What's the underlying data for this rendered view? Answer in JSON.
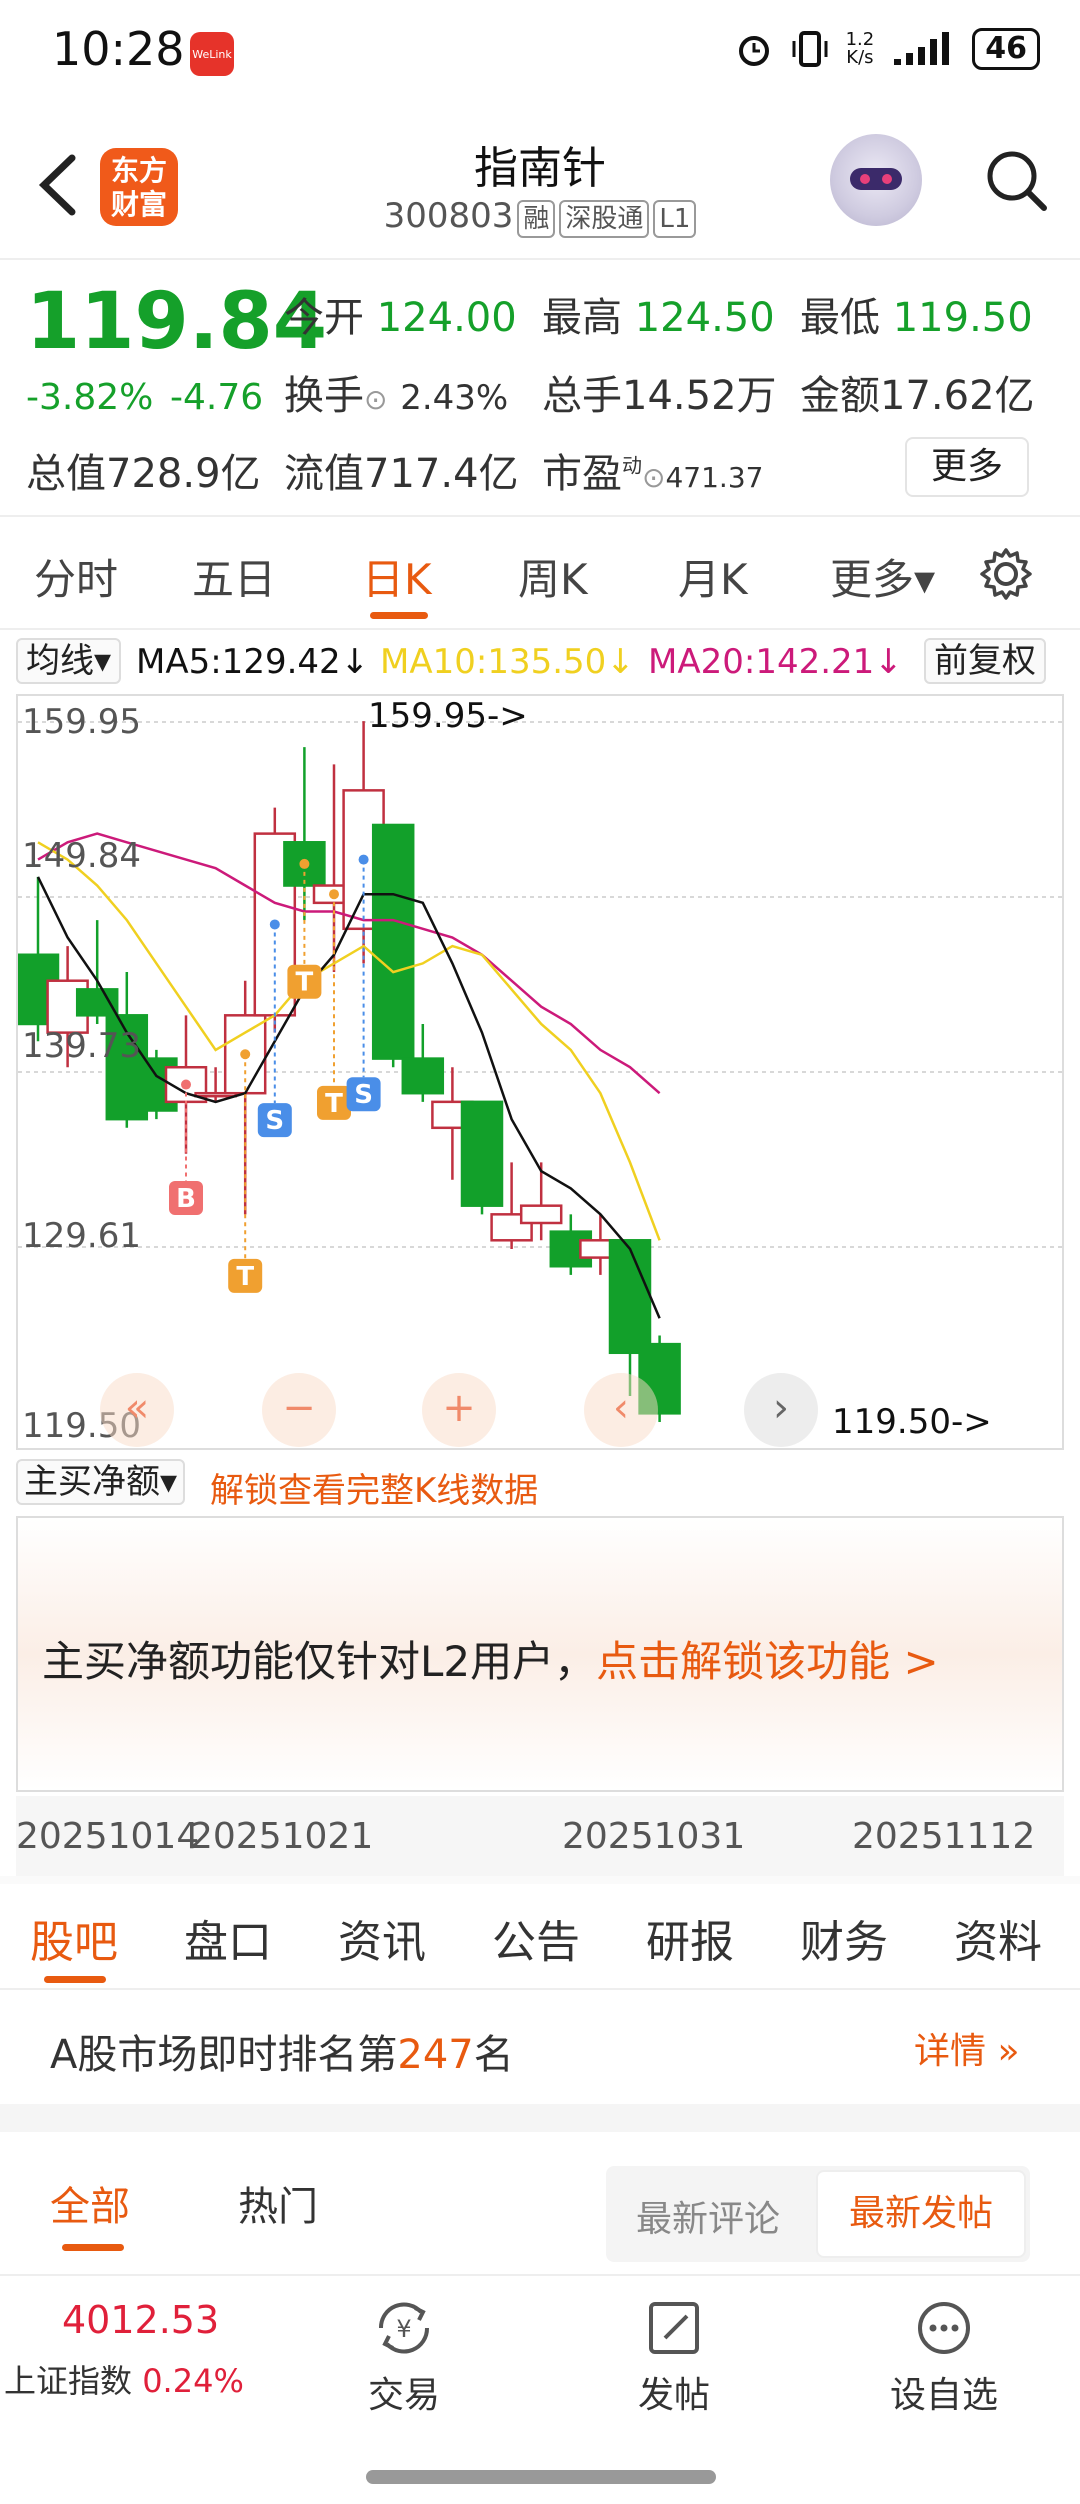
{
  "status_bar": {
    "time": "10:28",
    "app_badge": "WeLink",
    "net_speed": "1.2\nK/s",
    "battery": "46"
  },
  "header": {
    "logo": "东方财富",
    "stock_name": "指南针",
    "stock_code": "300803",
    "tags": [
      "融",
      "深股通",
      "L1"
    ]
  },
  "quote": {
    "price": "119.84",
    "change_pct": "-3.82%",
    "change_abs": "-4.76",
    "open_label": "今开",
    "open": "124.00",
    "high_label": "最高",
    "high": "124.50",
    "low_label": "最低",
    "low": "119.50",
    "turnover_label": "换手",
    "turnover": "2.43%",
    "volume_label": "总手",
    "volume": "14.52万",
    "amount_label": "金额",
    "amount": "17.62亿",
    "mktcap_label": "总值",
    "mktcap": "728.9亿",
    "float_label": "流值",
    "float_cap": "717.4亿",
    "pe_label": "市盈",
    "pe_sup": "动",
    "pe": "471.37",
    "more": "更多"
  },
  "period_tabs": [
    "分时",
    "五日",
    "日K",
    "周K",
    "月K",
    "更多▾"
  ],
  "period_active": "日K",
  "ma_bar": {
    "selector": "均线▾",
    "ma5": "MA5:129.42↓",
    "ma10": "MA10:135.50↓",
    "ma20": "MA20:142.21↓",
    "adjust": "前复权",
    "colors": {
      "ma5": "#111111",
      "ma10": "#f0d020",
      "ma20": "#cc1a7a"
    }
  },
  "chart_data": {
    "type": "candlestick",
    "y_ticks": [
      "159.95",
      "149.84",
      "139.73",
      "129.61",
      "119.50"
    ],
    "ylim": [
      119.5,
      159.95
    ],
    "max_annotation": "159.95->",
    "min_annotation": "119.50->",
    "candles": [
      {
        "o": 146.5,
        "c": 142.5,
        "h": 151.0,
        "l": 141.5
      },
      {
        "o": 142.0,
        "c": 145.0,
        "h": 147.0,
        "l": 140.0
      },
      {
        "o": 144.5,
        "c": 143.0,
        "h": 148.5,
        "l": 142.5
      },
      {
        "o": 143.0,
        "c": 137.0,
        "h": 145.5,
        "l": 136.5
      },
      {
        "o": 140.5,
        "c": 137.5,
        "h": 141.0,
        "l": 137.0
      },
      {
        "o": 138.0,
        "c": 140.0,
        "h": 143.0,
        "l": 135.0
      },
      {
        "o": 138.5,
        "c": 138.5,
        "h": 140.0,
        "l": 138.0
      },
      {
        "o": 138.5,
        "c": 143.0,
        "h": 145.0,
        "l": 131.5
      },
      {
        "o": 143.0,
        "c": 153.5,
        "h": 155.0,
        "l": 142.0
      },
      {
        "o": 153.0,
        "c": 150.5,
        "h": 158.5,
        "l": 148.5
      },
      {
        "o": 149.5,
        "c": 150.5,
        "h": 157.5,
        "l": 145.5
      },
      {
        "o": 148.0,
        "c": 156.0,
        "h": 160.0,
        "l": 146.0
      },
      {
        "o": 154.0,
        "c": 140.5,
        "h": 154.0,
        "l": 140.0
      },
      {
        "o": 140.5,
        "c": 138.5,
        "h": 142.5,
        "l": 138.0
      },
      {
        "o": 136.5,
        "c": 138.0,
        "h": 140.0,
        "l": 133.5
      },
      {
        "o": 138.0,
        "c": 132.0,
        "h": 138.0,
        "l": 131.5
      },
      {
        "o": 130.0,
        "c": 131.5,
        "h": 134.5,
        "l": 129.5
      },
      {
        "o": 131.0,
        "c": 132.0,
        "h": 134.5,
        "l": 130.0
      },
      {
        "o": 130.5,
        "c": 128.5,
        "h": 131.5,
        "l": 128.0
      },
      {
        "o": 129.0,
        "c": 130.0,
        "h": 131.5,
        "l": 128.0
      },
      {
        "o": 130.0,
        "c": 123.5,
        "h": 130.0,
        "l": 121.0
      },
      {
        "o": 124.0,
        "c": 120.0,
        "h": 124.5,
        "l": 119.5
      }
    ],
    "ma5": [
      151.0,
      147.5,
      145.0,
      142.0,
      139.5,
      138.5,
      138.0,
      138.5,
      141.5,
      144.5,
      146.5,
      150.0,
      150.0,
      149.5,
      146.0,
      142.0,
      137.0,
      134.0,
      133.0,
      131.5,
      129.5,
      125.5
    ],
    "ma10": [
      153.0,
      152.0,
      150.5,
      148.5,
      146.0,
      143.5,
      141.0,
      142.0,
      143.0,
      145.0,
      146.0,
      147.0,
      145.5,
      146.0,
      147.0,
      146.5,
      144.5,
      142.5,
      141.0,
      138.5,
      134.5,
      130.0
    ],
    "ma20": [
      152.0,
      153.0,
      153.5,
      153.0,
      152.5,
      152.0,
      151.5,
      150.5,
      149.5,
      149.0,
      149.0,
      148.5,
      148.5,
      148.0,
      147.5,
      146.5,
      145.0,
      143.5,
      142.5,
      141.0,
      140.0,
      138.5
    ],
    "markers": [
      {
        "idx": 5,
        "label": "B",
        "kind": "buy",
        "price": 132.5
      },
      {
        "idx": 7,
        "label": "T",
        "kind": "t",
        "price": 128.0
      },
      {
        "idx": 8,
        "label": "S",
        "kind": "sell",
        "price": 137.0
      },
      {
        "idx": 9,
        "label": "T",
        "kind": "t",
        "price": 145.0
      },
      {
        "idx": 10,
        "label": "T",
        "kind": "t",
        "price": 138.0
      },
      {
        "idx": 11,
        "label": "S",
        "kind": "sell",
        "price": 138.5
      }
    ]
  },
  "controls": [
    "«",
    "−",
    "+",
    "‹",
    "›"
  ],
  "flow": {
    "selector": "主买净额▾",
    "unlock": "解锁查看完整K线数据"
  },
  "l2": {
    "text": "主买净额功能仅针对L2用户，",
    "link": "点击解锁该功能 >"
  },
  "dates": [
    "20251014",
    "20251021",
    "20251031",
    "20251112"
  ],
  "info_tabs": [
    "股吧",
    "盘口",
    "资讯",
    "公告",
    "研报",
    "财务",
    "资料"
  ],
  "rank": {
    "prefix": "A股市场即时排名第",
    "num": "247",
    "suffix": "名",
    "detail": "详情 »"
  },
  "feed_tabs": [
    "全部",
    "热门"
  ],
  "sort_opts": [
    "最新评论",
    "最新发帖"
  ],
  "bottom": {
    "index_val": "4012.53",
    "index_name": "上证指数",
    "index_pct": "0.24%",
    "items": [
      "交易",
      "发帖",
      "设自选"
    ]
  }
}
